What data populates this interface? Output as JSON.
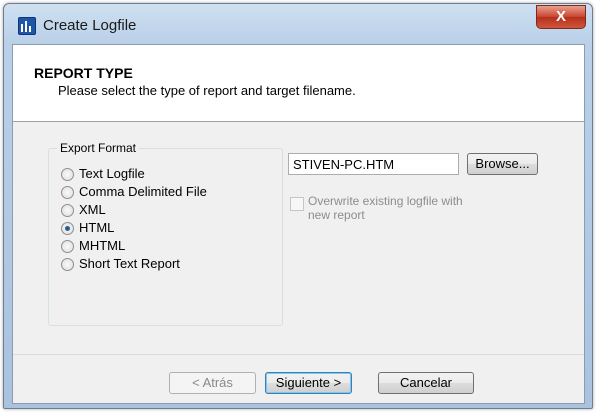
{
  "window": {
    "title": "Create Logfile",
    "close_glyph": "X"
  },
  "header": {
    "title": "REPORT TYPE",
    "subtitle": "Please select the type of report and target filename."
  },
  "export_format": {
    "label": "Export Format",
    "options": [
      {
        "label": "Text Logfile",
        "checked": false
      },
      {
        "label": "Comma Delimited File",
        "checked": false
      },
      {
        "label": "XML",
        "checked": false
      },
      {
        "label": "HTML",
        "checked": true
      },
      {
        "label": "MHTML",
        "checked": false
      },
      {
        "label": "Short Text Report",
        "checked": false
      }
    ]
  },
  "target": {
    "filename": "STIVEN-PC.HTM",
    "browse_label": "Browse...",
    "overwrite_label": "Overwrite existing logfile with new report",
    "overwrite_checked": false,
    "overwrite_enabled": false
  },
  "buttons": {
    "back_label": "< Atrás",
    "next_label": "Siguiente >",
    "cancel_label": "Cancelar"
  },
  "colors": {
    "accent": "#1e56a8",
    "close": "#c7442e",
    "disabled_text": "#8d8d8d"
  },
  "icons": {
    "app": "logfile-app-icon",
    "close": "close-icon"
  }
}
